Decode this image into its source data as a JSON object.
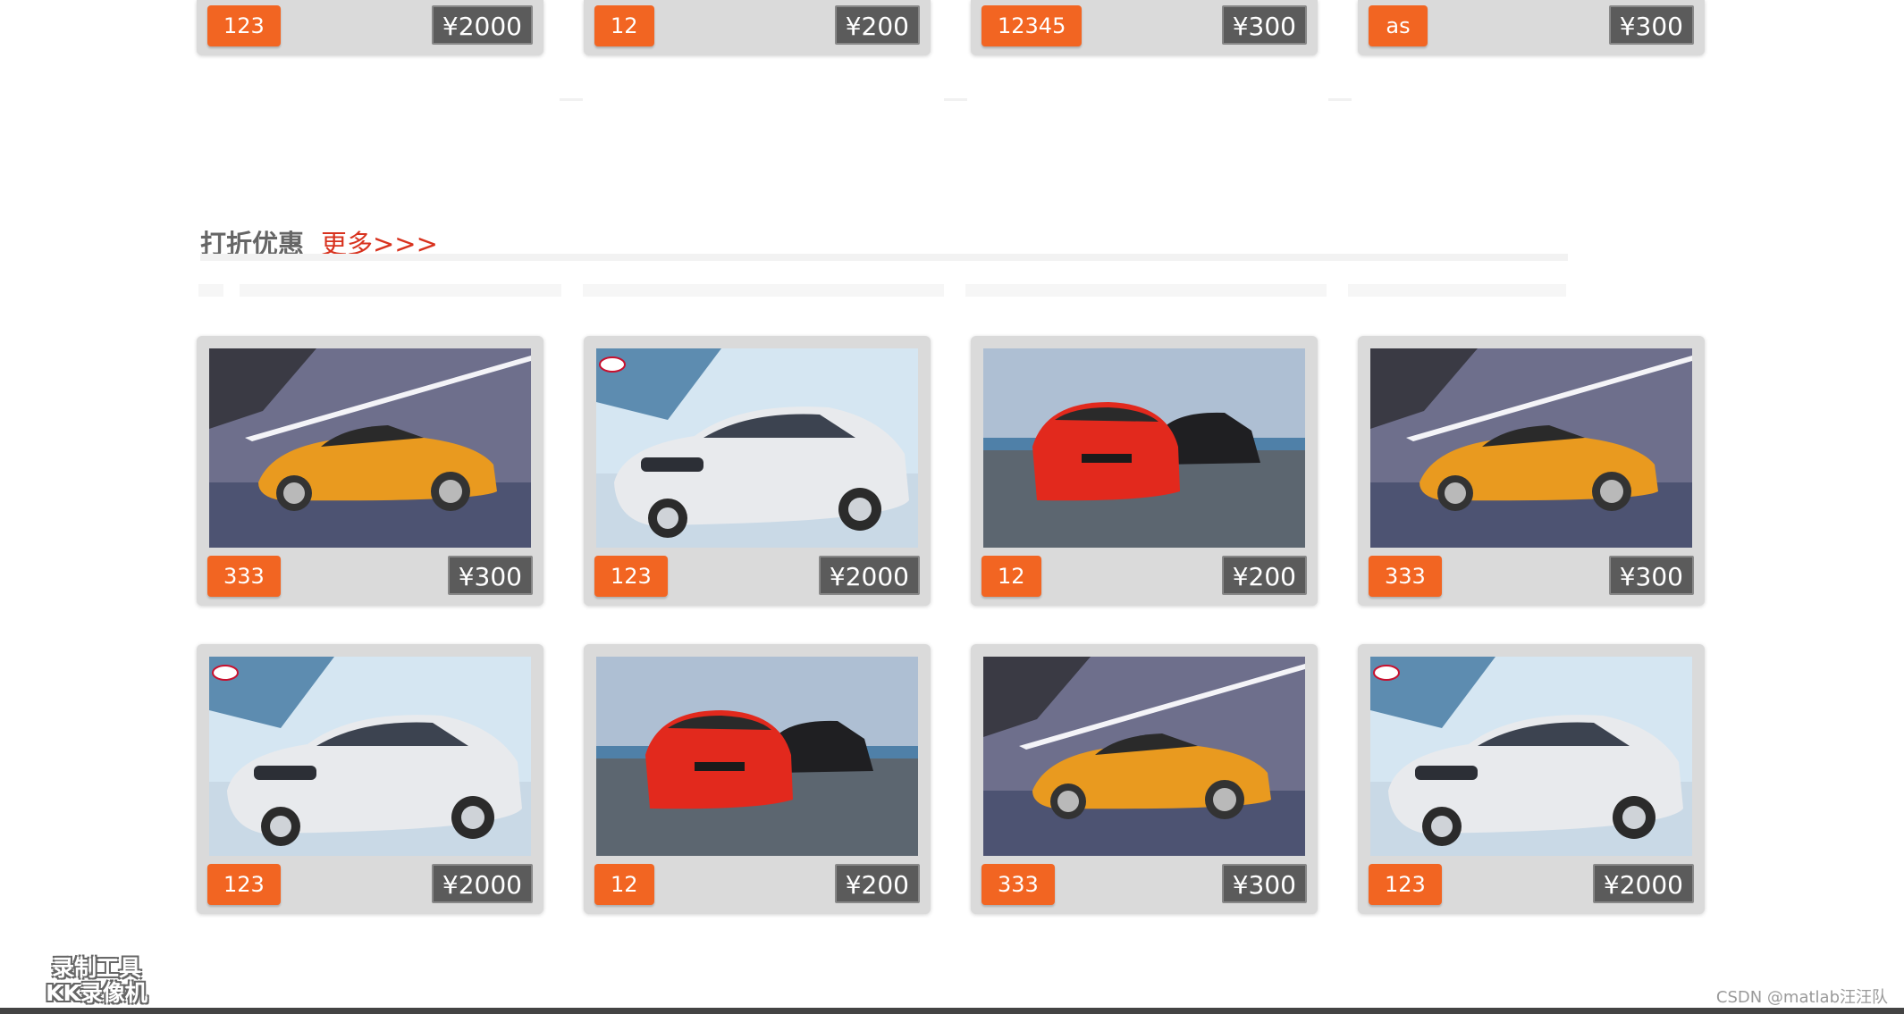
{
  "top_row": [
    {
      "tag": "123",
      "price": "¥2000"
    },
    {
      "tag": "12",
      "price": "¥200"
    },
    {
      "tag": "12345",
      "price": "¥300"
    },
    {
      "tag": "as",
      "price": "¥300"
    }
  ],
  "section": {
    "title": "打折优惠",
    "more": "更多>>>"
  },
  "products": [
    {
      "tag": "333",
      "price": "¥300",
      "image": "orange-coupe"
    },
    {
      "tag": "123",
      "price": "¥2000",
      "image": "silver-kia-sedan"
    },
    {
      "tag": "12",
      "price": "¥200",
      "image": "red-bmw"
    },
    {
      "tag": "333",
      "price": "¥300",
      "image": "orange-coupe"
    },
    {
      "tag": "123",
      "price": "¥2000",
      "image": "silver-kia-sedan"
    },
    {
      "tag": "12",
      "price": "¥200",
      "image": "red-bmw"
    },
    {
      "tag": "333",
      "price": "¥300",
      "image": "orange-coupe"
    },
    {
      "tag": "123",
      "price": "¥2000",
      "image": "silver-kia-sedan"
    }
  ],
  "watermark": {
    "line1": "录制工具",
    "line2": "KK录像机"
  },
  "credit": "CSDN @matlab汪汪队",
  "colors": {
    "tag": "#f26522",
    "price": "#5b5b5b",
    "more_link": "#d8321e",
    "card": "#dadada"
  }
}
